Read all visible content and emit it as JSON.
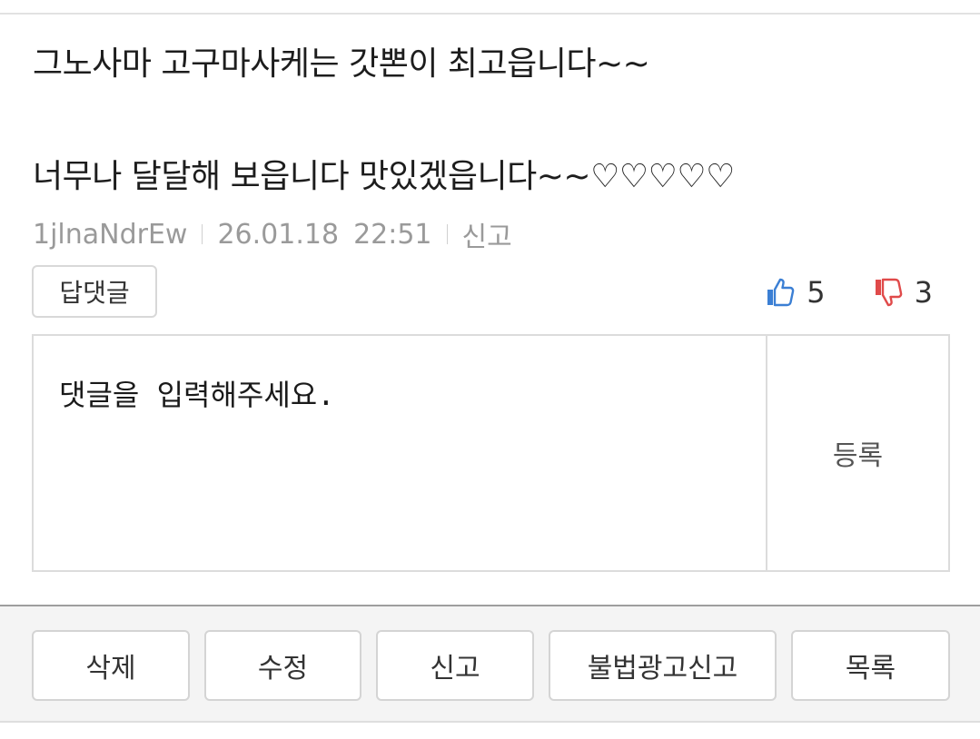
{
  "comment": {
    "text": "그노사마 고구마사케는 갓뽄이 최고읍니다~~\n\n너무나 달달해 보읍니다 맛있겠읍니다~~♡♡♡♡♡",
    "author": "1jlnaNdrEw",
    "date": "26.01.18",
    "time": "22:51",
    "report_label": "신고"
  },
  "reply_button_label": "답댓글",
  "votes": {
    "up_icon": "thumbs-up-icon",
    "up_count": "5",
    "down_icon": "thumbs-down-icon",
    "down_count": "3",
    "up_color": "#3b7fd4",
    "down_color": "#e04a4a"
  },
  "reply_form": {
    "placeholder": "댓글을 입력해주세요.",
    "submit_label": "등록"
  },
  "actions": {
    "delete_label": "삭제",
    "edit_label": "수정",
    "report_label": "신고",
    "illegal_ad_report_label": "불법광고신고",
    "list_label": "목록"
  }
}
